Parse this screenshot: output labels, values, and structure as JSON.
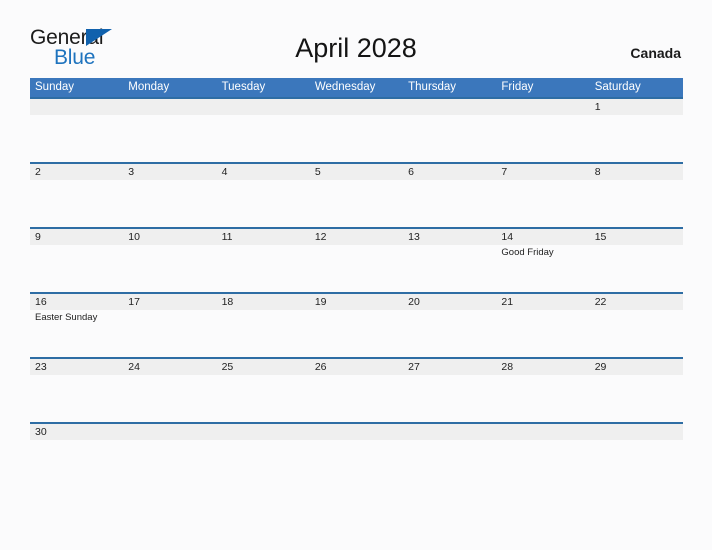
{
  "brand": {
    "name_part1": "General",
    "name_part2": "Blue",
    "triangle_icon": "blue-triangle-icon",
    "accent_color": "#1e73be"
  },
  "header": {
    "title": "April 2028",
    "country": "Canada"
  },
  "colors": {
    "header_blue": "#3b77bc",
    "row_divider_blue": "#2e6da4",
    "date_band_gray": "#efefef",
    "page_background": "#fbfbfc",
    "text": "#222222"
  },
  "calendar": {
    "month": "April",
    "year": "2028",
    "day_headers": [
      "Sunday",
      "Monday",
      "Tuesday",
      "Wednesday",
      "Thursday",
      "Friday",
      "Saturday"
    ],
    "weeks": [
      {
        "days": [
          {
            "date": "",
            "event": ""
          },
          {
            "date": "",
            "event": ""
          },
          {
            "date": "",
            "event": ""
          },
          {
            "date": "",
            "event": ""
          },
          {
            "date": "",
            "event": ""
          },
          {
            "date": "",
            "event": ""
          },
          {
            "date": "1",
            "event": ""
          }
        ]
      },
      {
        "days": [
          {
            "date": "2",
            "event": ""
          },
          {
            "date": "3",
            "event": ""
          },
          {
            "date": "4",
            "event": ""
          },
          {
            "date": "5",
            "event": ""
          },
          {
            "date": "6",
            "event": ""
          },
          {
            "date": "7",
            "event": ""
          },
          {
            "date": "8",
            "event": ""
          }
        ]
      },
      {
        "days": [
          {
            "date": "9",
            "event": ""
          },
          {
            "date": "10",
            "event": ""
          },
          {
            "date": "11",
            "event": ""
          },
          {
            "date": "12",
            "event": ""
          },
          {
            "date": "13",
            "event": ""
          },
          {
            "date": "14",
            "event": "Good Friday"
          },
          {
            "date": "15",
            "event": ""
          }
        ]
      },
      {
        "days": [
          {
            "date": "16",
            "event": "Easter Sunday"
          },
          {
            "date": "17",
            "event": ""
          },
          {
            "date": "18",
            "event": ""
          },
          {
            "date": "19",
            "event": ""
          },
          {
            "date": "20",
            "event": ""
          },
          {
            "date": "21",
            "event": ""
          },
          {
            "date": "22",
            "event": ""
          }
        ]
      },
      {
        "days": [
          {
            "date": "23",
            "event": ""
          },
          {
            "date": "24",
            "event": ""
          },
          {
            "date": "25",
            "event": ""
          },
          {
            "date": "26",
            "event": ""
          },
          {
            "date": "27",
            "event": ""
          },
          {
            "date": "28",
            "event": ""
          },
          {
            "date": "29",
            "event": ""
          }
        ]
      },
      {
        "days": [
          {
            "date": "30",
            "event": ""
          },
          {
            "date": "",
            "event": ""
          },
          {
            "date": "",
            "event": ""
          },
          {
            "date": "",
            "event": ""
          },
          {
            "date": "",
            "event": ""
          },
          {
            "date": "",
            "event": ""
          },
          {
            "date": "",
            "event": ""
          }
        ]
      }
    ]
  }
}
